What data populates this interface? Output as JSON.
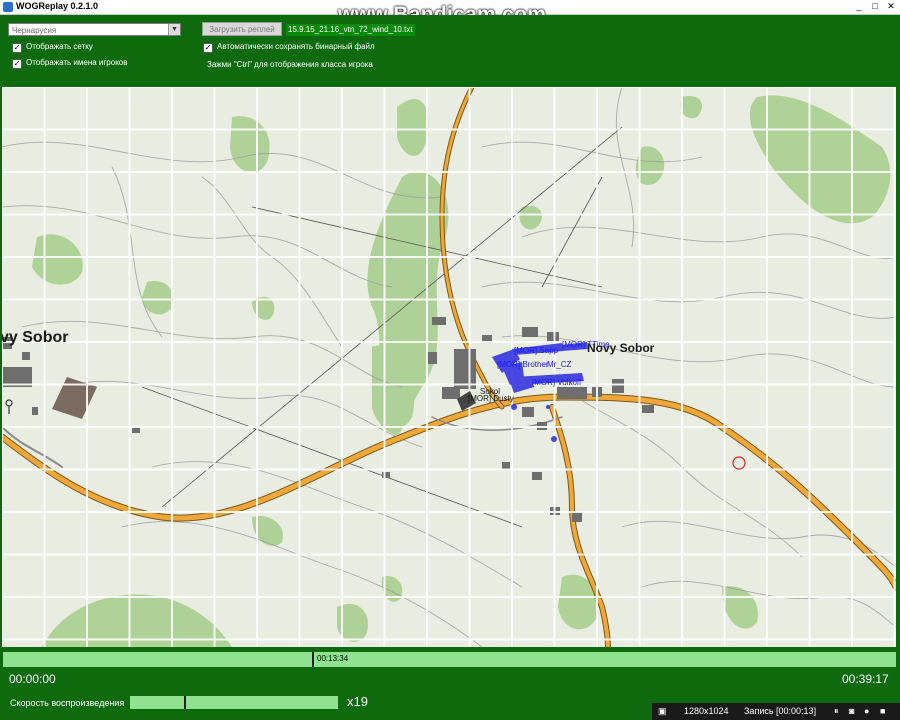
{
  "window": {
    "title": "WOGReplay 0.2.1.0",
    "minimize": "_",
    "maximize": "□",
    "close": "✕"
  },
  "watermark": "www.Bandicam.com",
  "controls": {
    "map_select": "Чернарусия",
    "load_button": "Загрузить реплей",
    "file_name": "15.9.15_21.16_vtn_72_wind_10.txt",
    "show_grid": "Отображать сетку",
    "show_names": "Отображать имена игроков",
    "auto_save": "Автоматически сохранять бинарный файл",
    "ctrl_hint": "Зажми \"Ctrl\" для отображения класса игрока"
  },
  "map": {
    "town_label_left": "vy Sobor",
    "town_label_right": "Novy Sobor",
    "player_label_1": "[MOR] Dusty",
    "player_label_2": "Sokol",
    "player_label_3": "[MOR] Brother",
    "player_label_4": "Mr_CZ",
    "player_label_5": "[MOR] TTime",
    "player_label_6": "[MOR] Sapp",
    "player_label_7": "[MOR] Volkoff",
    "colors": {
      "grid": "#ffffff",
      "road": "#e9a22e",
      "forest": "#a8cf8f",
      "players": "#1a1aff"
    }
  },
  "timeline": {
    "current_time_label": "00:13:34",
    "progress": 0.346,
    "start_time": "00:00:00",
    "end_time": "00:39:17"
  },
  "playback": {
    "speed_label": "Скорость воспроизведения",
    "speed_value": "x19",
    "speed_fraction": 0.26
  },
  "recorder": {
    "resolution": "1280x1024",
    "recording": "Запись [00:00:13]"
  }
}
